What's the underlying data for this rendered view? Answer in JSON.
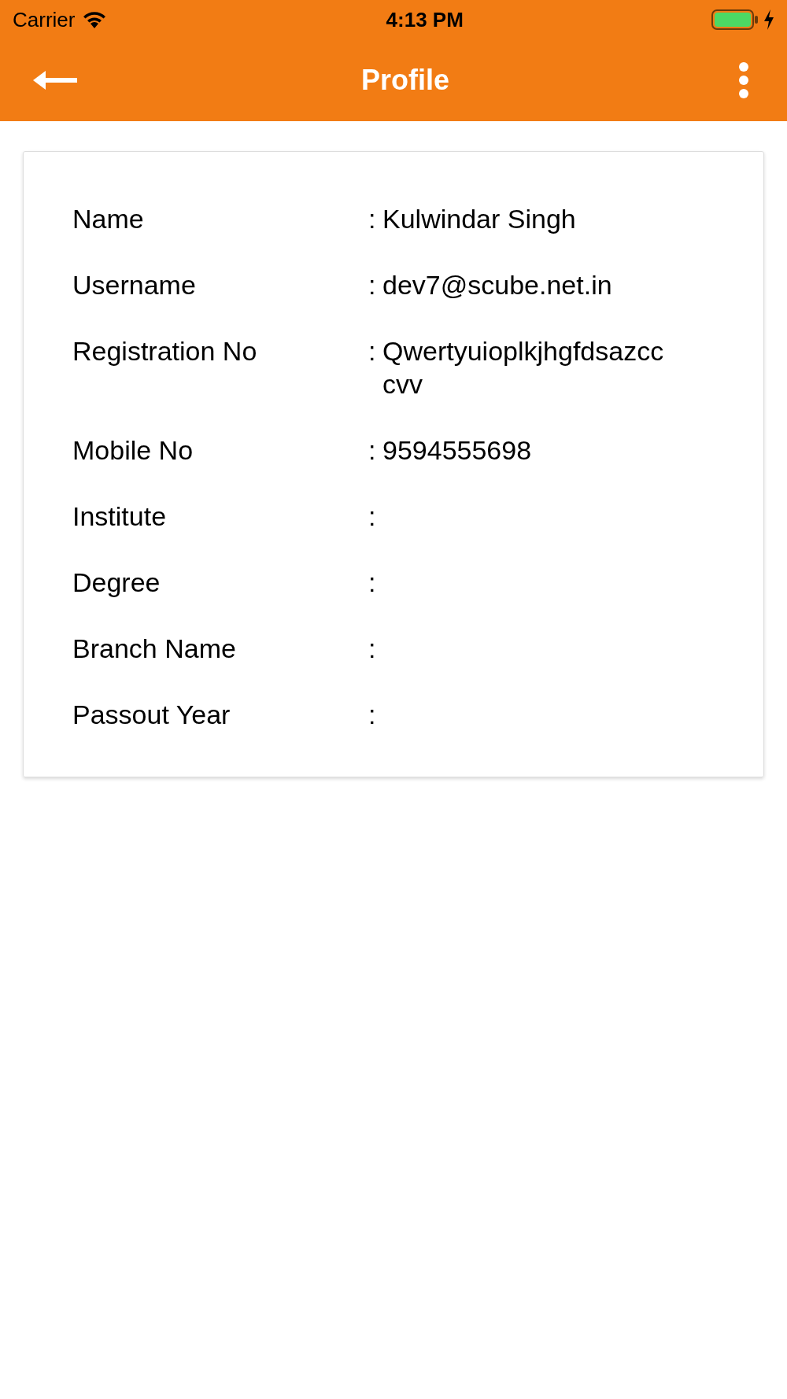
{
  "status_bar": {
    "carrier": "Carrier",
    "time": "4:13 PM"
  },
  "nav_bar": {
    "title": "Profile"
  },
  "profile": [
    {
      "label": "Name",
      "value": "Kulwindar Singh"
    },
    {
      "label": "Username",
      "value": "dev7@scube.net.in"
    },
    {
      "label": "Registration No",
      "value": "Qwertyuioplkjhgfdsazcccvv"
    },
    {
      "label": "Mobile No",
      "value": "9594555698"
    },
    {
      "label": "Institute"
    },
    {
      "label": "Degree"
    },
    {
      "label": "Branch Name"
    },
    {
      "label": "Passout Year"
    }
  ],
  "separator": ":"
}
